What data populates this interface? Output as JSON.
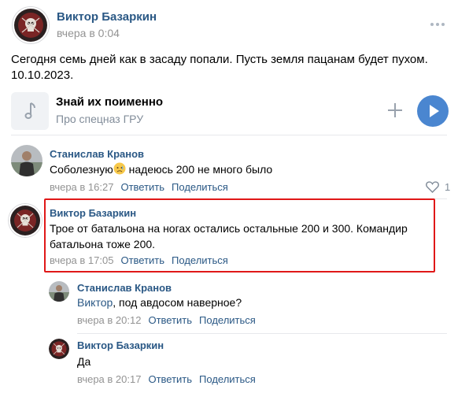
{
  "post": {
    "author": "Виктор Базаркин",
    "time": "вчера в 0:04",
    "text_line1": "Сегодня семь дней как в засаду попали. Пусть земля пацанам будет пухом.",
    "text_line2": "10.10.2023."
  },
  "audio": {
    "title": "Знай их поименно",
    "artist": "Про спецназ ГРУ"
  },
  "actions": {
    "reply": "Ответить",
    "share": "Поделиться"
  },
  "comments": [
    {
      "author": "Станислав Кранов",
      "text": "Соболезную",
      "text_after": " надеюсь 200 не много было",
      "time": "вчера в 16:27",
      "likes": "1"
    },
    {
      "author": "Виктор Базаркин",
      "text": "Трое от батальона на ногах остались остальные 200 и 300. Командир батальона тоже 200.",
      "time": "вчера в 17:05"
    }
  ],
  "replies": [
    {
      "author": "Станислав Кранов",
      "mention": "Виктор",
      "text": ", под авдосом наверное?",
      "time": "вчера в 20:12"
    },
    {
      "author": "Виктор Базаркин",
      "text": "Да",
      "time": "вчера в 20:17"
    }
  ],
  "colors": {
    "link": "#2a5885",
    "muted": "#939393",
    "accent": "#4a86d0",
    "highlight": "#e01818"
  }
}
